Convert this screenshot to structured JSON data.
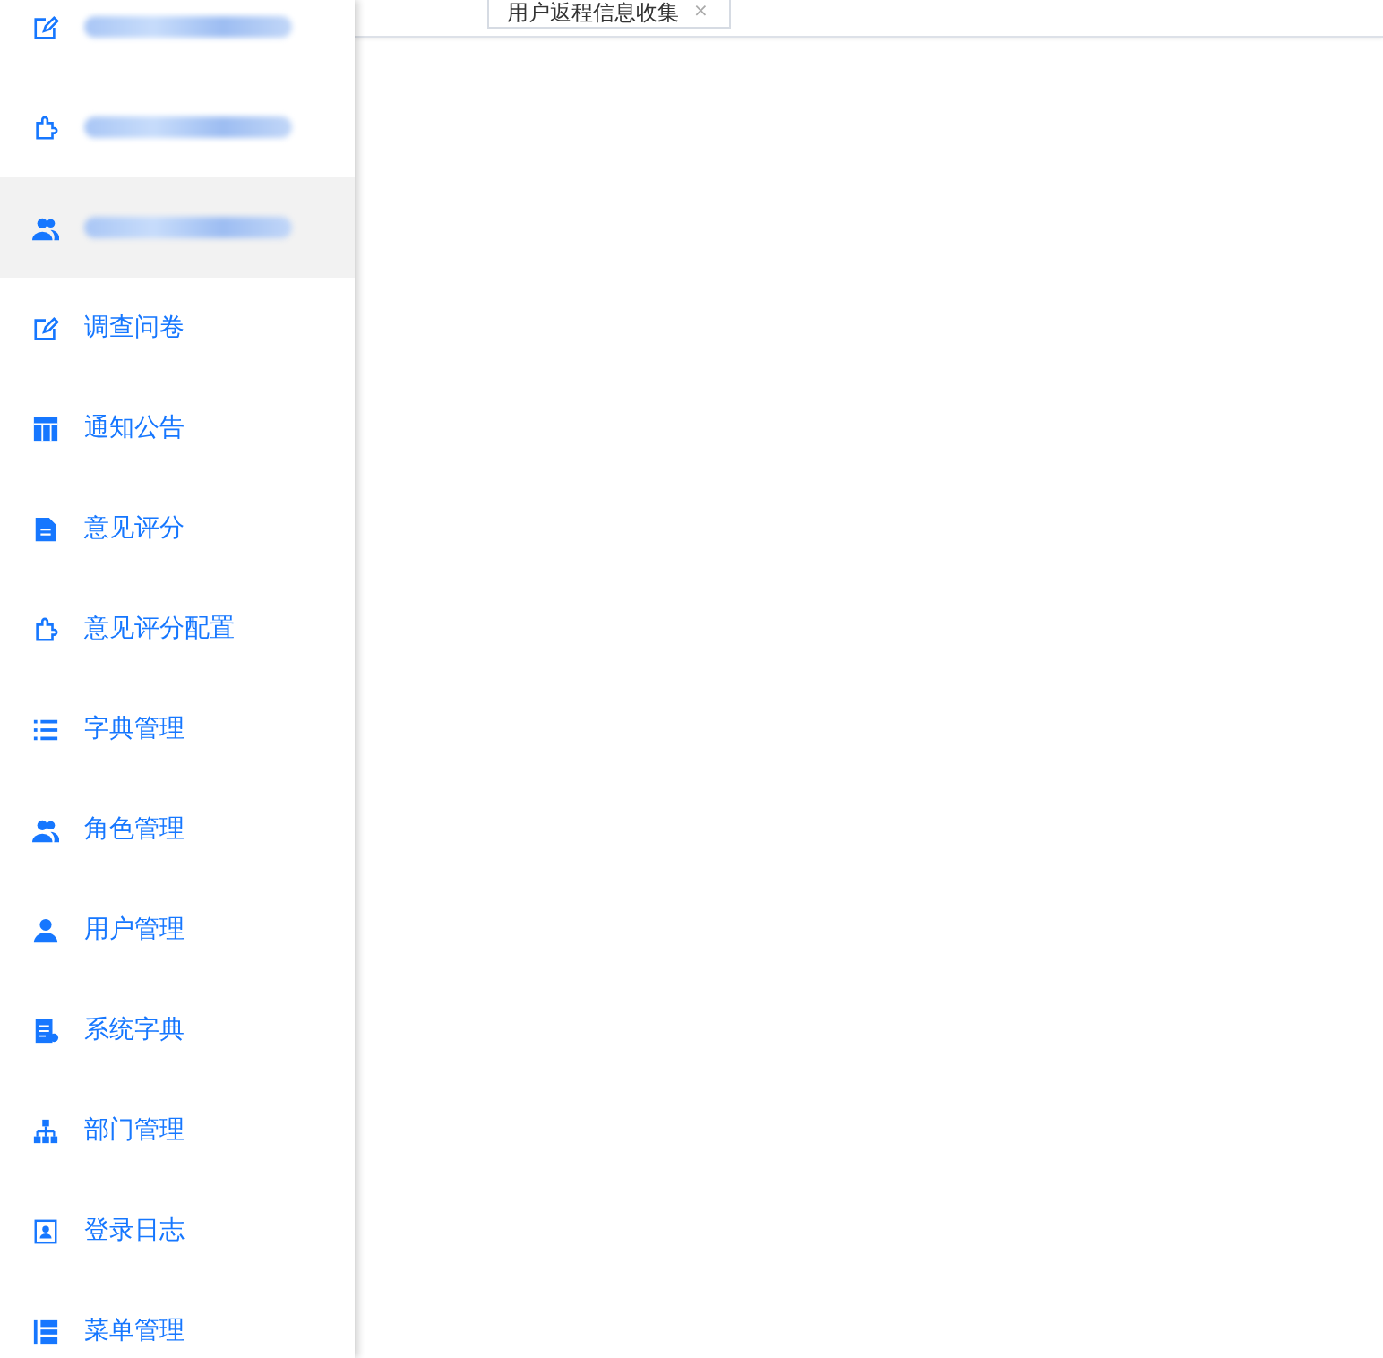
{
  "sidebar": {
    "items": [
      {
        "kind": "redacted",
        "selected": false
      },
      {
        "kind": "redacted",
        "selected": false
      },
      {
        "kind": "redacted",
        "selected": true
      },
      {
        "kind": "link",
        "label": "调查问卷",
        "selected": false
      },
      {
        "kind": "link",
        "label": "通知公告",
        "selected": false
      },
      {
        "kind": "link",
        "label": "意见评分",
        "selected": false
      },
      {
        "kind": "link",
        "label": "意见评分配置",
        "selected": false
      },
      {
        "kind": "link",
        "label": "字典管理",
        "selected": false
      },
      {
        "kind": "link",
        "label": "角色管理",
        "selected": false
      },
      {
        "kind": "link",
        "label": "用户管理",
        "selected": false
      },
      {
        "kind": "link",
        "label": "系统字典",
        "selected": false
      },
      {
        "kind": "link",
        "label": "部门管理",
        "selected": false
      },
      {
        "kind": "link",
        "label": "登录日志",
        "selected": false
      },
      {
        "kind": "link",
        "label": "菜单管理",
        "selected": false
      }
    ]
  },
  "tabs": [
    {
      "label": "用户返程信息收集",
      "close": "×"
    }
  ]
}
